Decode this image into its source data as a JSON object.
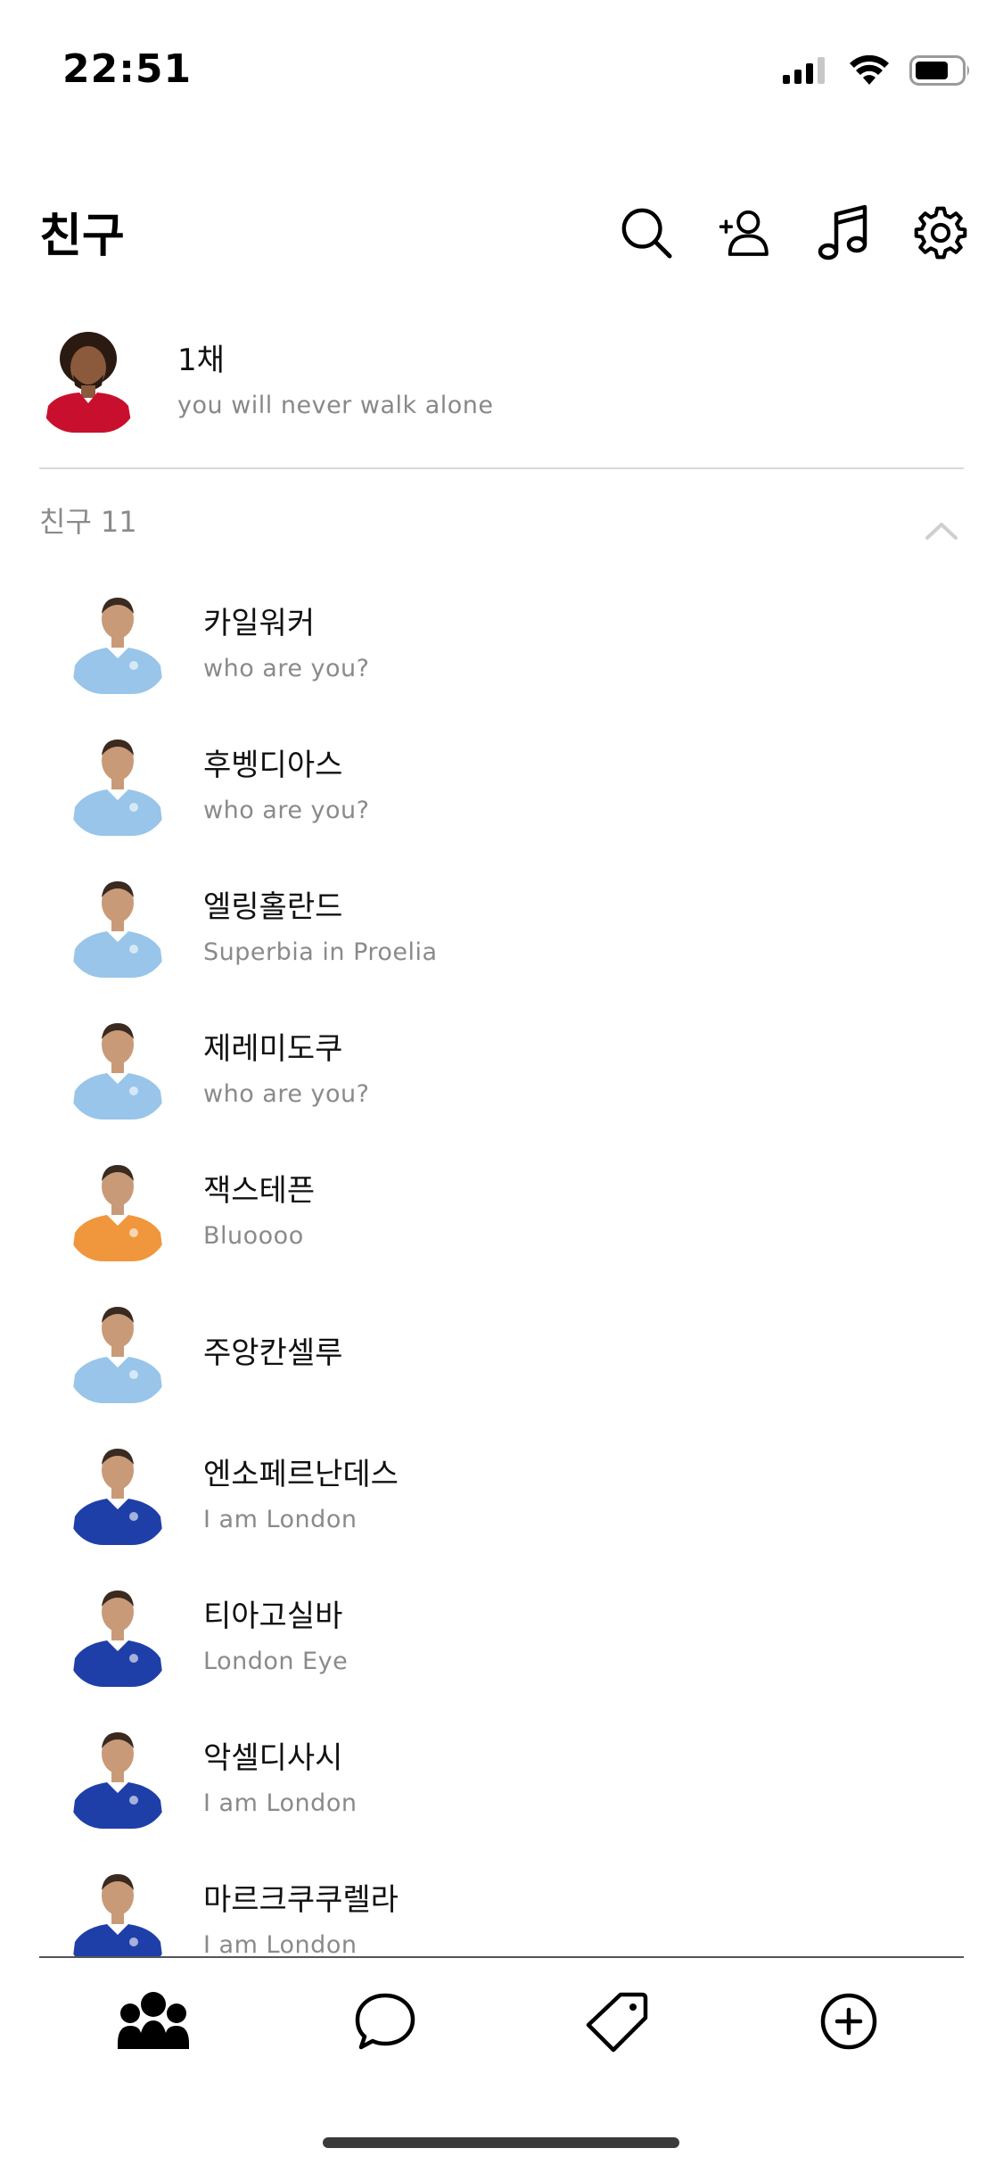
{
  "status_bar": {
    "time": "22:51"
  },
  "header": {
    "title": "친구",
    "icons": [
      "search-icon",
      "add-friend-icon",
      "music-icon",
      "settings-icon"
    ]
  },
  "profile": {
    "name": "1채",
    "status": "you will never walk alone",
    "jersey_color": "#c8102e"
  },
  "friends_section": {
    "label": "친구",
    "count": "11"
  },
  "friends": [
    {
      "name": "카일워커",
      "status": "who are you?",
      "jersey_color": "#98c5e9"
    },
    {
      "name": "후벵디아스",
      "status": "who are you?",
      "jersey_color": "#98c5e9"
    },
    {
      "name": "엘링홀란드",
      "status": "Superbia in Proelia",
      "jersey_color": "#98c5e9"
    },
    {
      "name": "제레미도쿠",
      "status": "who are you?",
      "jersey_color": "#98c5e9"
    },
    {
      "name": "잭스테픈",
      "status": "Bluoooo",
      "jersey_color": "#f0963c"
    },
    {
      "name": "주앙칸셀루",
      "status": "",
      "jersey_color": "#98c5e9"
    },
    {
      "name": "엔소페르난데스",
      "status": "I am London",
      "jersey_color": "#1f3fa8"
    },
    {
      "name": "티아고실바",
      "status": "London Eye",
      "jersey_color": "#1f3fa8"
    },
    {
      "name": "악셀디사시",
      "status": "I am London",
      "jersey_color": "#1f3fa8"
    },
    {
      "name": "마르크쿠쿠렐라",
      "status": "I am London",
      "jersey_color": "#1f3fa8"
    }
  ],
  "tab_bar": {
    "tabs": [
      "friends-tab",
      "chat-tab",
      "shopping-tab",
      "more-tab"
    ],
    "active": "friends-tab"
  }
}
